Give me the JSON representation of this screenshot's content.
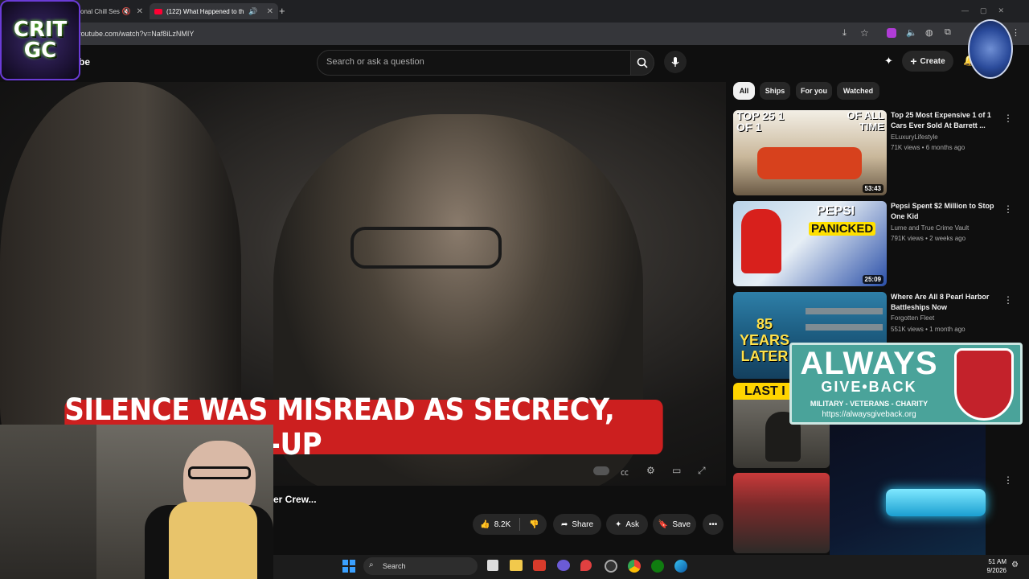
{
  "browser": {
    "tabs": [
      {
        "label": "onal Chill Ses",
        "active": false
      },
      {
        "label": "(122) What Happened to th",
        "active": true
      }
    ],
    "new_tab": "+",
    "url": "youtube.com/watch?v=Naf8iLzNMIY"
  },
  "youtube": {
    "logo_text": "be",
    "search_placeholder": "Search or ask a question",
    "create_label": "Create"
  },
  "video": {
    "caption": "SILENCE WAS MISREAD AS SECRECY, NOT A COVER-UP",
    "title_partial": "er Crew...",
    "actions": {
      "like_count": "8.2K",
      "share": "Share",
      "ask": "Ask",
      "save": "Save"
    }
  },
  "chips": [
    "All",
    "Ships",
    "For you",
    "Watched"
  ],
  "recommendations": [
    {
      "thumb_text_left": "TOP 25 1 OF 1",
      "thumb_text_right": "OF ALL TIME",
      "duration": "53:43",
      "title": "Top 25 Most Expensive 1 of 1 Cars Ever Sold At Barrett ...",
      "channel": "ELuxuryLifestyle",
      "meta": "71K views • 6 months ago"
    },
    {
      "thumb_text_left": "PEPSI",
      "thumb_text_right": "PANICKED",
      "duration": "25:09",
      "title": "Pepsi Spent $2 Million to Stop One Kid",
      "channel": "Lume and True Crime Vault",
      "meta": "791K views • 2 weeks ago"
    },
    {
      "thumb_text_left": "85 YEARS LATER",
      "thumb_text_right": "",
      "duration": "",
      "title": "Where Are All 8 Pearl Harbor Battleships Now",
      "channel": "Forgotten Fleet",
      "meta": "551K views • 1 month ago"
    },
    {
      "thumb_text_left": "LAST I",
      "thumb_text_right": "",
      "duration": "",
      "title": "",
      "channel": "",
      "meta": ""
    }
  ],
  "overlays": {
    "logo_line1": "CRIT",
    "logo_line2": "GC",
    "sponsor_line1": "ALWAYS",
    "sponsor_line2": "GIVE•BACK",
    "sponsor_line3": "MILITARY - VETERANS - CHARITY",
    "sponsor_url": "https://alwaysgiveback.org"
  },
  "taskbar": {
    "search_label": "Search",
    "time": "51 AM",
    "date": "9/2026"
  },
  "colors": {
    "caption_bg": "#cc1f1f",
    "sponsor_bg": "#4aa39a",
    "yt_bg": "#0f0f0f"
  }
}
